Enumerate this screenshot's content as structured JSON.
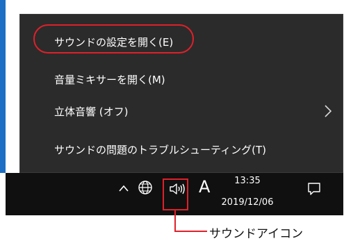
{
  "context_menu": {
    "items": [
      {
        "label": "サウンドの設定を開く(E)"
      },
      {
        "label": "音量ミキサーを開く(M)"
      },
      {
        "label": "立体音響 (オフ)",
        "has_submenu": true,
        "icon": "chevron-right-icon"
      },
      {
        "label": "サウンドの問題のトラブルシューティング(T)"
      }
    ]
  },
  "taskbar": {
    "icons": [
      "caret-up-icon",
      "globe-icon",
      "speaker-icon",
      "notification-icon"
    ],
    "ime_mode": "A",
    "time": "13:35",
    "date": "2019/12/06"
  },
  "annotations": {
    "speaker_callout": "サウンドアイコン",
    "highlight_color": "#e0202a"
  }
}
